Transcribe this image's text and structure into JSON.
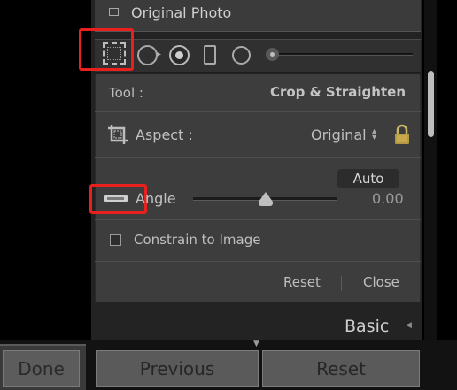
{
  "photo_options": {
    "original_label": "Original Photo"
  },
  "tool_strip": {
    "tools": [
      "crop-overlay-icon",
      "spot-removal-icon",
      "red-eye-icon",
      "graduated-filter-icon",
      "radial-filter-icon",
      "adjustment-brush-icon"
    ],
    "highlight_color": "#e8211e"
  },
  "crop_panel": {
    "tool_label": "Tool :",
    "tool_value": "Crop & Straighten",
    "aspect_label": "Aspect :",
    "aspect_value": "Original",
    "aspect_arrows": "⇕",
    "auto_label": "Auto",
    "angle_label": "Angle",
    "angle_value": "0.00",
    "constrain_label": "Constrain to Image",
    "reset_label": "Reset",
    "close_label": "Close"
  },
  "next_panel": {
    "title": "Basic"
  },
  "bottom_bar": {
    "done_label": "Done",
    "previous_label": "Previous",
    "reset_label": "Reset"
  }
}
